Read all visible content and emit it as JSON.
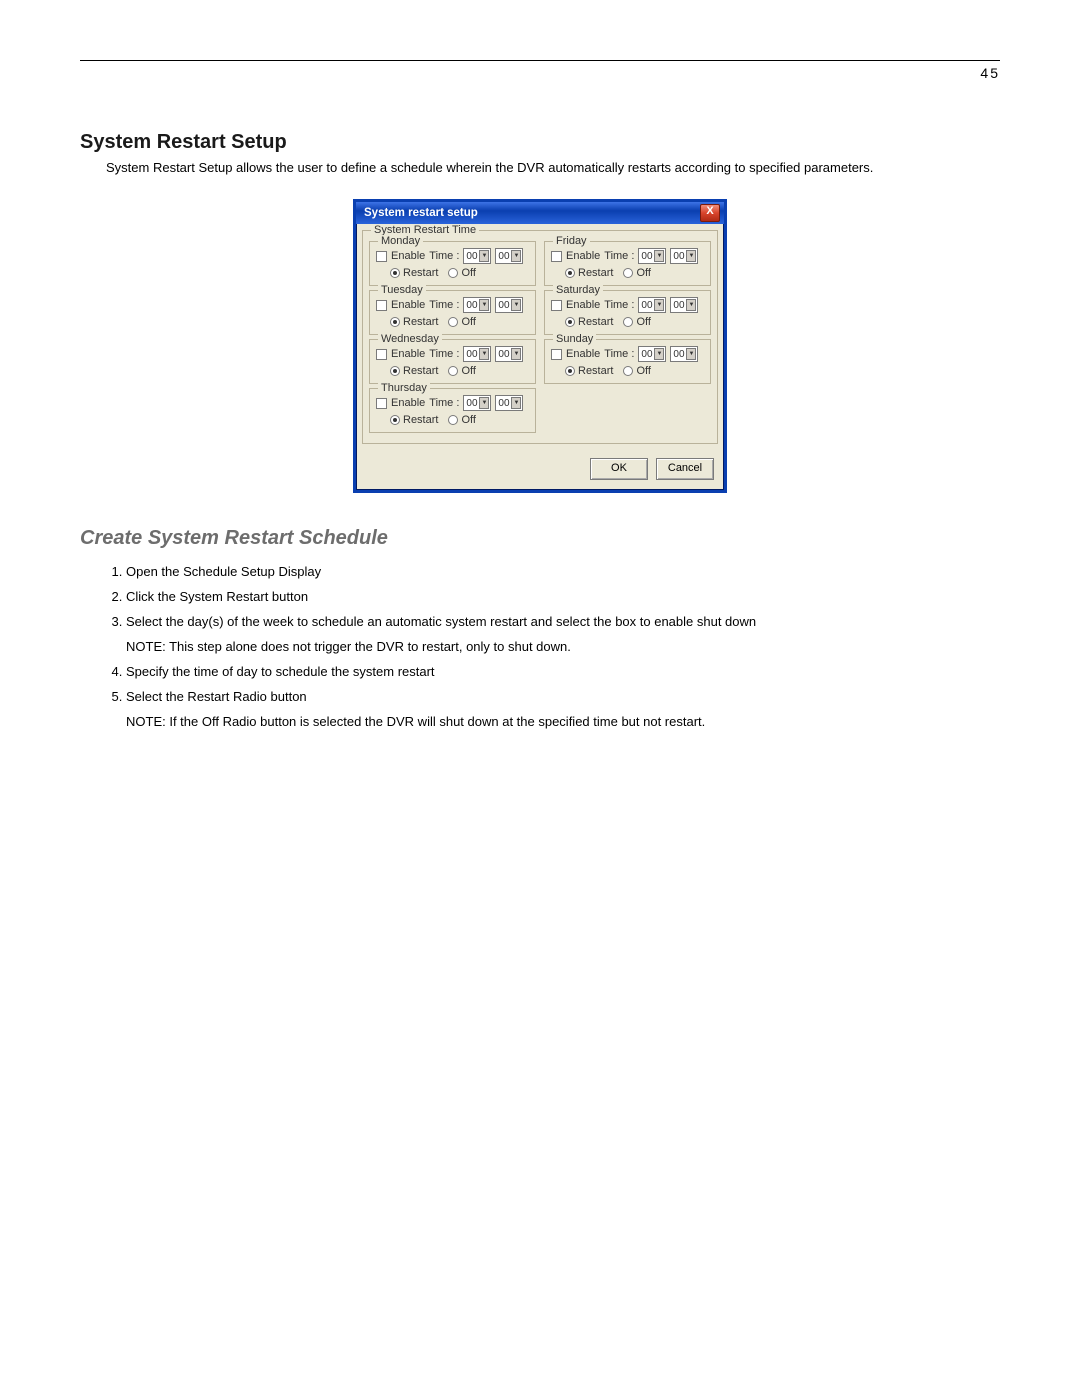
{
  "page_number": "45",
  "heading": "System Restart Setup",
  "intro": "System Restart Setup allows the user to define a schedule wherein the DVR automatically restarts according to specified parameters.",
  "dialog": {
    "title": "System restart setup",
    "close_glyph": "X",
    "group_label": "System Restart Time",
    "enable_label": "Enable",
    "time_label": "Time :",
    "hour_value": "00",
    "min_value": "00",
    "restart_label": "Restart",
    "off_label": "Off",
    "ok_label": "OK",
    "cancel_label": "Cancel",
    "days_left": [
      "Monday",
      "Tuesday",
      "Wednesday",
      "Thursday"
    ],
    "days_right": [
      "Friday",
      "Saturday",
      "Sunday"
    ]
  },
  "subheading": "Create System Restart Schedule",
  "steps": {
    "s1": "Open the Schedule Setup Display",
    "s2": "Click the System Restart button",
    "s3": "Select the day(s) of the week to schedule an automatic system restart and select the box to enable shut down",
    "s4": "Specify the time of day to schedule the system restart",
    "s5": "Select the Restart Radio button"
  },
  "notes": {
    "n1": "NOTE: This step alone does not trigger the DVR to restart, only to shut down.",
    "n2": "NOTE: If the Off Radio button is selected the DVR will shut down at the specified time but not restart."
  }
}
